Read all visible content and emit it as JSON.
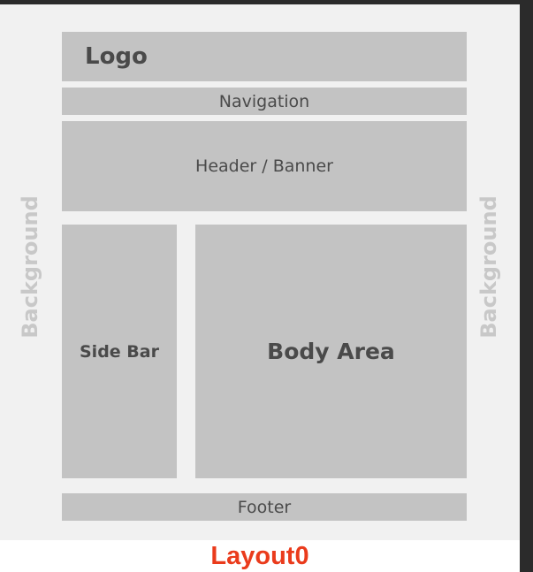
{
  "diagram": {
    "blocks": {
      "logo": "Logo",
      "navigation": "Navigation",
      "header": "Header / Banner",
      "sidebar": "Side Bar",
      "body": "Body Area",
      "footer": "Footer"
    },
    "background_label_left": "Background",
    "background_label_right": "Background",
    "caption": "Layout0"
  },
  "colors": {
    "block": "#c3c3c3",
    "canvas": "#f1f1f1",
    "caption": "#ea3b1c",
    "background_label": "#c8c8c8"
  }
}
